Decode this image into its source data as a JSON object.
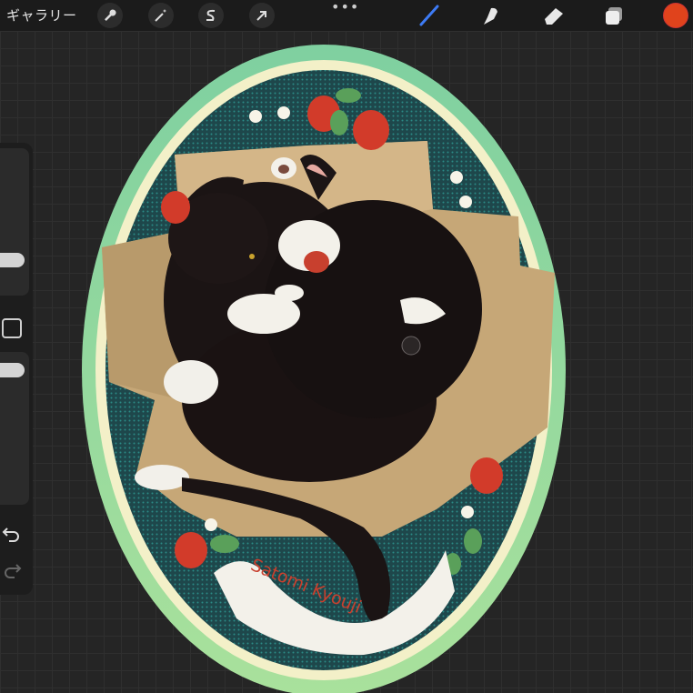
{
  "app": {
    "gallery_label": "ギャラリー",
    "more_label": "•••"
  },
  "toolbar_left": [
    {
      "name": "actions",
      "icon": "wrench-icon"
    },
    {
      "name": "adjustments",
      "icon": "magic-wand-icon"
    },
    {
      "name": "selection",
      "icon": "selection-s-icon"
    },
    {
      "name": "transform",
      "icon": "arrow-cursor-icon"
    }
  ],
  "toolbar_right": [
    {
      "name": "brush",
      "icon": "brush-icon",
      "active": true
    },
    {
      "name": "smudge",
      "icon": "smudge-icon"
    },
    {
      "name": "eraser",
      "icon": "eraser-icon"
    },
    {
      "name": "layers",
      "icon": "layers-icon"
    }
  ],
  "current_color": "#e0431c",
  "accent_color": "#3d7bf5",
  "artwork": {
    "signature_text": "Satomi Kyouji",
    "colors": {
      "outer_ring": "#8fd3a4",
      "cream_ring": "#f2efc4",
      "inner_field": "#1f4a4e",
      "cardboard": "#c7a878",
      "cat_black": "#1a1414",
      "cat_white": "#f3f1ea",
      "strawberry": "#d23b2a",
      "leaf": "#5aa05a"
    }
  }
}
